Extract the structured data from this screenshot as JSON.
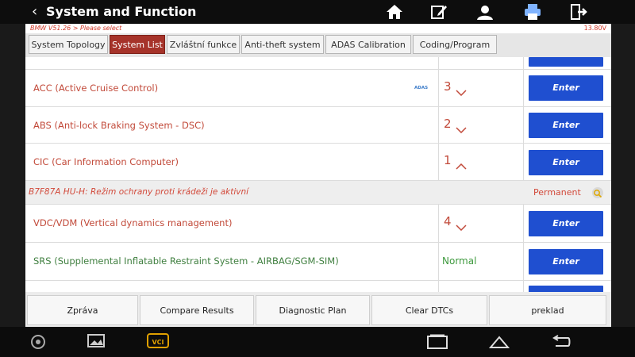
{
  "window": {
    "title": "System and Function",
    "back_glyph": "‹"
  },
  "top_icons": [
    "home-icon",
    "edit-icon",
    "user-icon",
    "print-icon",
    "exit-icon"
  ],
  "status_bar": {
    "breadcrumb": "BMW V51.26 > Please select",
    "voltage": "13.80V"
  },
  "tabs": [
    {
      "label": "System Topology",
      "active": false
    },
    {
      "label": "System List",
      "active": true
    },
    {
      "label": "Zvláštní funkce",
      "active": false
    },
    {
      "label": "Anti-theft system",
      "active": false
    },
    {
      "label": "ADAS Calibration",
      "active": false
    },
    {
      "label": "Coding/Program",
      "active": false
    }
  ],
  "systems": [
    {
      "name": "ACC (Active Cruise Control)",
      "badge": "ADAS",
      "count": "3",
      "chevron": "down",
      "action": "Enter"
    },
    {
      "name": "ABS (Anti-lock Braking System - DSC)",
      "count": "2",
      "chevron": "down",
      "action": "Enter"
    },
    {
      "name": "CIC (Car Information Computer)",
      "count": "1",
      "chevron": "up",
      "action": "Enter"
    },
    {
      "name": "VDC/VDM (Vertical dynamics management)",
      "count": "4",
      "chevron": "down",
      "action": "Enter"
    },
    {
      "name": "SRS (Supplemental Inflatable Restraint System - AIRBAG/SGM-SIM)",
      "status": "Normal",
      "action": "Enter"
    }
  ],
  "fault": {
    "text": "B7F87A HU-H: Režim ochrany proti krádeži je aktivní",
    "status": "Permanent"
  },
  "bottom_buttons": [
    "Zpráva",
    "Compare Results",
    "Diagnostic Plan",
    "Clear DTCs",
    "preklad"
  ],
  "android_nav": {
    "vci_label": "VCI"
  },
  "colors": {
    "accent_red": "#a6332a",
    "enter_blue": "#1f4fd0",
    "system_text": "#c24a3a",
    "normal_green": "#3f9a3f"
  }
}
